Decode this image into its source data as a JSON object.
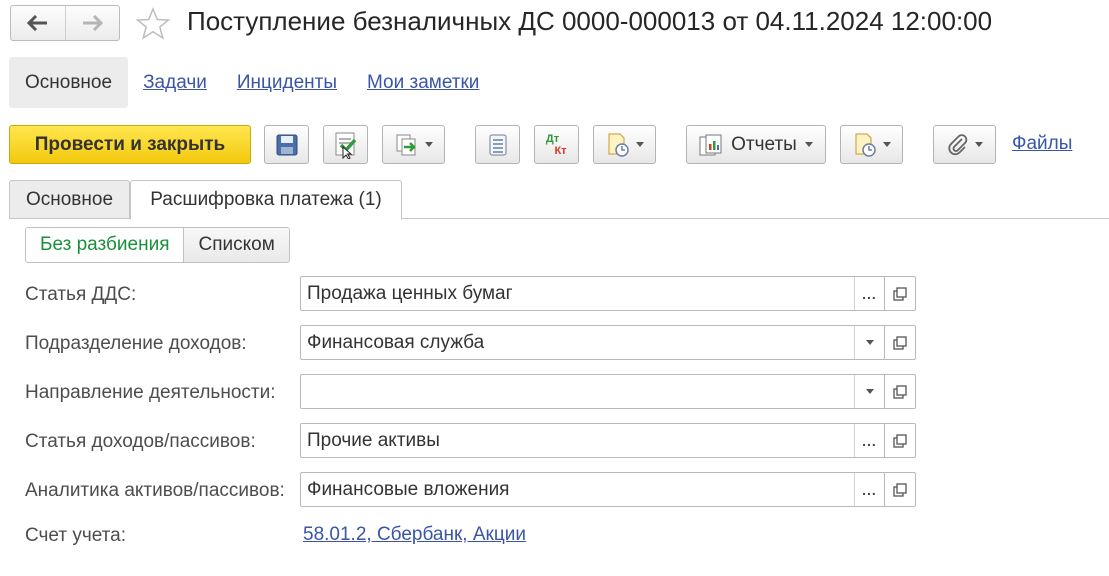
{
  "window": {
    "title": "Поступление безналичных ДС 0000-000013 от 04.11.2024 12:00:00"
  },
  "nav": {
    "back_icon": "arrow-left-icon",
    "forward_icon": "arrow-right-icon",
    "favorite_icon": "star-icon"
  },
  "sections": [
    {
      "label": "Основное",
      "active": true
    },
    {
      "label": "Задачи"
    },
    {
      "label": "Инциденты"
    },
    {
      "label": "Мои заметки"
    }
  ],
  "toolbar": {
    "post_close_label": "Провести и закрыть",
    "reports_label": "Отчеты",
    "files_label": "Файлы",
    "dtkt_top": "Дт",
    "dtkt_bottom": "Кт",
    "icons": [
      "save-icon",
      "post-icon",
      "create-based-on-icon",
      "list-icon",
      "dt-kt-icon",
      "print-icon",
      "reports-icon",
      "print-settings-icon",
      "attach-icon"
    ]
  },
  "form_tabs": [
    {
      "label": "Основное"
    },
    {
      "label": "Расшифровка платежа (1)",
      "active": true
    }
  ],
  "split_switch": {
    "no_split": "Без разбиения",
    "list": "Списком"
  },
  "fields": {
    "dds_item": {
      "label": "Статья ДДС:",
      "value": "Продажа ценных бумаг"
    },
    "income_dept": {
      "label": "Подразделение доходов:",
      "value": "Финансовая служба"
    },
    "activity": {
      "label": "Направление деятельности:",
      "value": ""
    },
    "income_item": {
      "label": "Статья доходов/пассивов:",
      "value": "Прочие активы"
    },
    "asset_analytics": {
      "label": "Аналитика активов/пассивов:",
      "value": "Финансовые вложения"
    },
    "account": {
      "label": "Счет учета:",
      "value": "58.01.2, Сбербанк, Акции"
    }
  },
  "colors": {
    "primary_button": "#f5cd12",
    "link": "#3a55a7",
    "switch_active": "#1a8f3a"
  }
}
